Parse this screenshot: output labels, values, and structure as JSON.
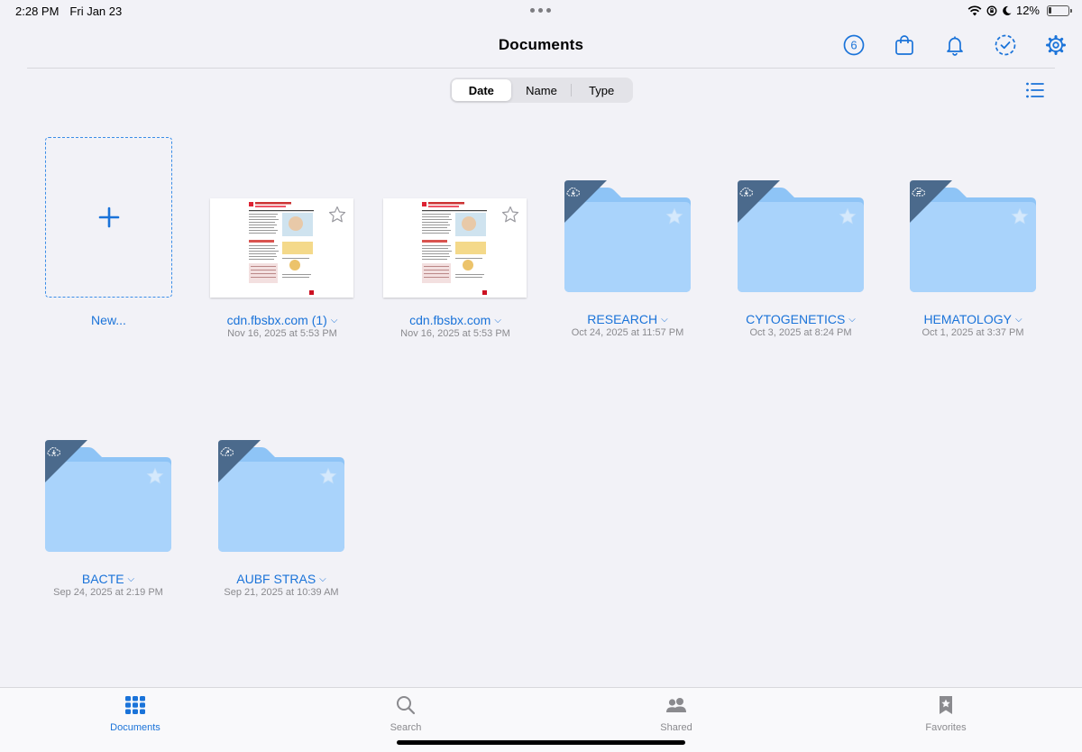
{
  "status": {
    "time": "2:28 PM",
    "date": "Fri Jan 23",
    "battery": "12%",
    "battery_level": 0.12
  },
  "header": {
    "title": "Documents",
    "badge_count": "6"
  },
  "sort": {
    "options": [
      "Date",
      "Name",
      "Type"
    ],
    "selected": "Date"
  },
  "new_item": {
    "label": "New..."
  },
  "items": [
    {
      "name": "cdn.fbsbx.com (1)",
      "date": "Nov 16, 2025 at 5:53 PM",
      "kind": "document"
    },
    {
      "name": "cdn.fbsbx.com",
      "date": "Nov 16, 2025 at 5:53 PM",
      "kind": "document"
    },
    {
      "name": "RESEARCH",
      "date": "Oct 24, 2025 at 11:57 PM",
      "kind": "folder",
      "badge": "cloud-download-icon"
    },
    {
      "name": "CYTOGENETICS",
      "date": "Oct 3, 2025 at 8:24 PM",
      "kind": "folder",
      "badge": "cloud-download-icon"
    },
    {
      "name": "HEMATOLOGY",
      "date": "Oct 1, 2025 at 3:37 PM",
      "kind": "folder",
      "badge": "cloud-sync-icon"
    },
    {
      "name": "BACTE",
      "date": "Sep 24, 2025 at 2:19 PM",
      "kind": "folder",
      "badge": "cloud-download-icon"
    },
    {
      "name": "AUBF STRAS",
      "date": "Sep 21, 2025 at 10:39 AM",
      "kind": "folder",
      "badge": "cloud-upload-icon"
    }
  ],
  "tabbar": {
    "tabs": [
      {
        "label": "Documents",
        "icon": "grid-icon",
        "active": true
      },
      {
        "label": "Search",
        "icon": "search-icon",
        "active": false
      },
      {
        "label": "Shared",
        "icon": "people-icon",
        "active": false
      },
      {
        "label": "Favorites",
        "icon": "star-bookmark-icon",
        "active": false
      }
    ]
  },
  "colors": {
    "accent": "#1a73d9",
    "folder": "#a9d3fb",
    "folder_tab": "#8ec4f6",
    "badge": "#4b6a8c",
    "inactive": "#8a8a8e"
  }
}
